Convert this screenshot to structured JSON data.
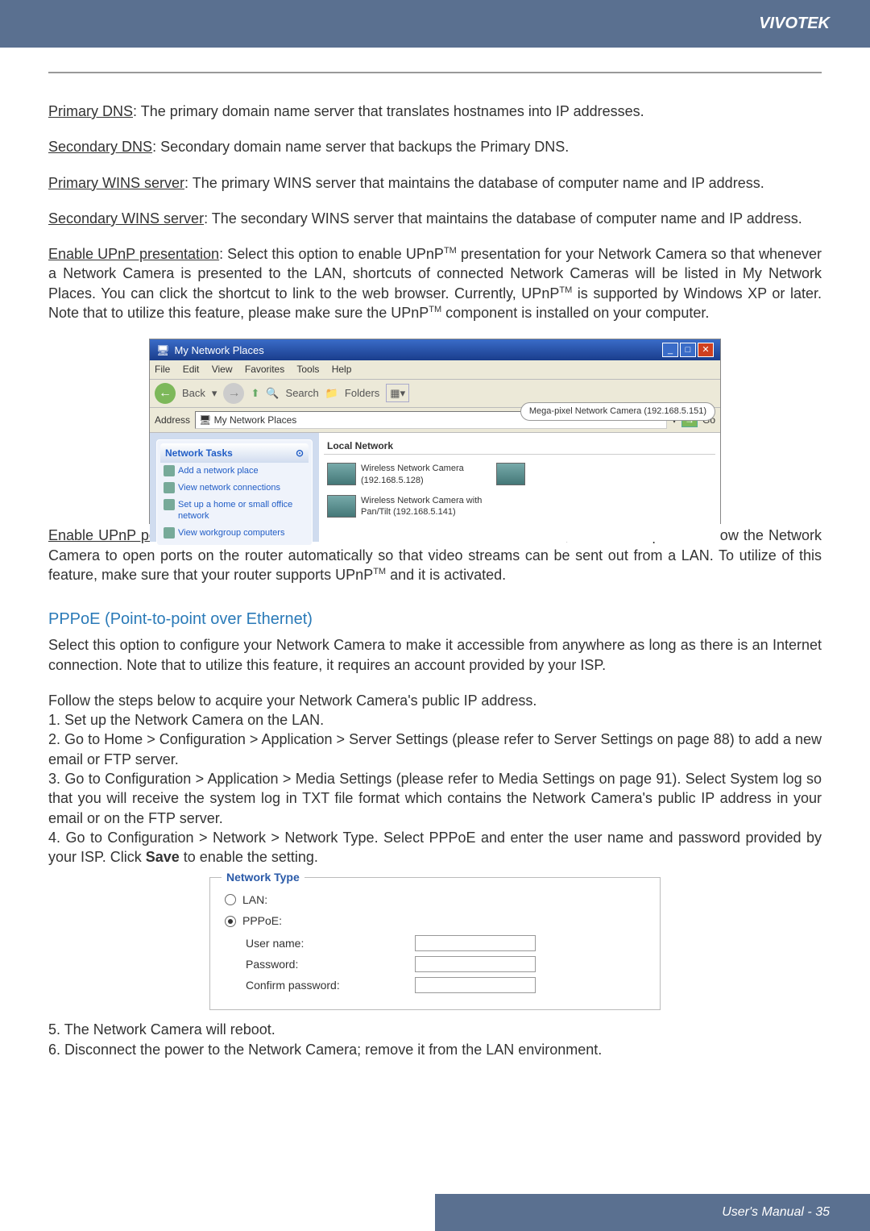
{
  "header": {
    "brand": "VIVOTEK"
  },
  "defs": {
    "primary_dns": {
      "term": "Primary DNS",
      "text": ": The primary domain name server that translates hostnames into IP addresses."
    },
    "secondary_dns": {
      "term": "Secondary DNS",
      "text": ": Secondary domain name server that backups the Primary DNS."
    },
    "primary_wins": {
      "term": "Primary WINS server",
      "text": ": The primary WINS server that maintains the database of computer name and IP address."
    },
    "secondary_wins": {
      "term": "Secondary WINS server",
      "text": ": The secondary WINS server that maintains the database of computer name and IP address."
    },
    "upnp_presentation": {
      "term": "Enable UPnP presentation",
      "text1": ": Select this option to enable UPnP",
      "text2": " presentation for your Network Camera so that whenever a Network Camera is presented to the LAN, shortcuts of connected Network Cameras will be listed in My Network Places. You can click the shortcut to link to the web browser. Currently, UPnP",
      "text3": " is supported by Windows XP or later. Note that to utilize this feature, please make sure the UPnP",
      "text4": " component is installed on your computer."
    },
    "upnp_port": {
      "term": "Enable UPnP port forwarding",
      "text1": ": To access the Network Camera from the Internet, select this option to allow the Network Camera to open ports on the router automatically so that video streams can be sent out from a LAN. To utilize of this feature, make sure that your router supports UPnP",
      "text2": " and it is activated."
    }
  },
  "tm": "TM",
  "shot1": {
    "title": "My Network Places",
    "menus": [
      "File",
      "Edit",
      "View",
      "Favorites",
      "Tools",
      "Help"
    ],
    "toolbar": {
      "back": "Back",
      "search": "Search",
      "folders": "Folders"
    },
    "address_label": "Address",
    "address_value": "My Network Places",
    "go": "Go",
    "sidebar_title": "Network Tasks",
    "sidebar_items": [
      "Add a network place",
      "View network connections",
      "Set up a home or small office network",
      "View workgroup computers"
    ],
    "content_header": "Local Network",
    "item1_line1": "Wireless Network Camera",
    "item1_line2": "(192.168.5.128)",
    "item2_line1": "Wireless Network Camera with",
    "item2_line2": "Pan/Tilt (192.168.5.141)",
    "callout": "Mega-pixel Network Camera (192.168.5.151)"
  },
  "pppoe": {
    "heading": "PPPoE (Point-to-point over Ethernet)",
    "intro": "Select this option to configure your Network Camera to make it accessible from anywhere as long as there is an Internet connection. Note that to utilize this feature, it requires an account provided by your ISP.",
    "follow": "Follow the steps below to acquire your Network Camera's public IP address.",
    "steps": [
      "1. Set up the Network Camera on the LAN.",
      "2. Go to Home > Configuration > Application > Server Settings (please refer to Server Settings on page 88) to add a new email or FTP server.",
      "3. Go to Configuration > Application > Media Settings (please refer to Media Settings on page 91). Select System log so that you will receive the system log in TXT file format which contains the Network Camera's public IP address in your email or on the FTP server.",
      "4. Go to Configuration > Network > Network Type. Select PPPoE and enter the user name and password provided by your ISP. Click Save to enable the setting."
    ],
    "step5": "5. The Network Camera will reboot.",
    "step6": "6. Disconnect the power to the Network Camera; remove it from the LAN environment."
  },
  "shot2": {
    "legend": "Network Type",
    "lan": "LAN:",
    "pppoe": "PPPoE:",
    "user": "User name:",
    "pass": "Password:",
    "confirm": "Confirm password:"
  },
  "footer": "User's Manual - 35"
}
